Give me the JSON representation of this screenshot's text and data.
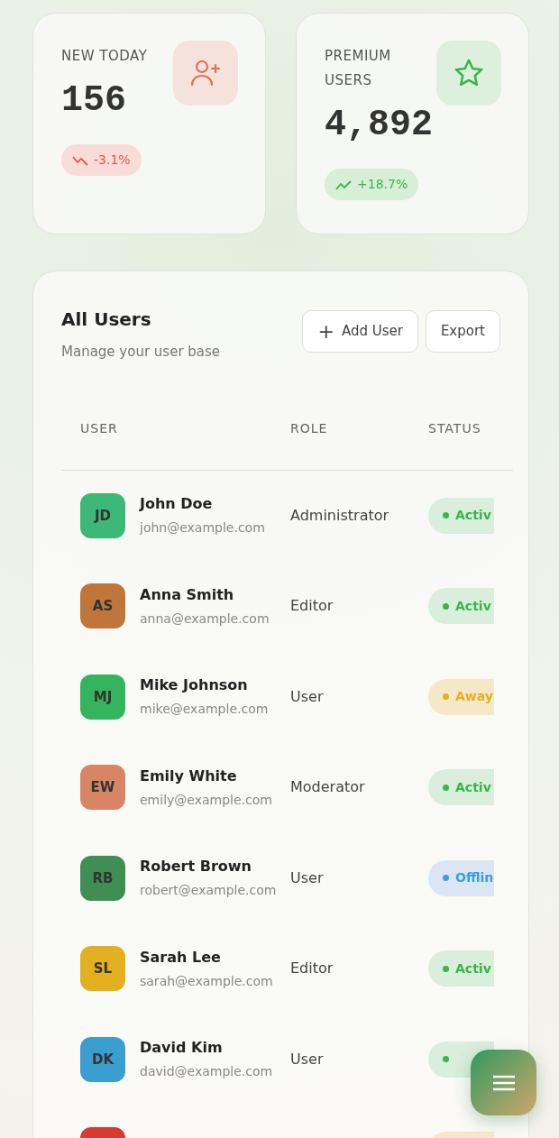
{
  "stats": [
    {
      "label": "NEW TODAY",
      "value": "156",
      "change": "-3.1%",
      "kind": "down"
    },
    {
      "label": "PREMIUM USERS",
      "value": "4,892",
      "change": "+18.7%",
      "kind": "up"
    }
  ],
  "users_card": {
    "title": "All Users",
    "subtitle": "Manage your user base",
    "buttons": [
      {
        "label": "Add User",
        "symbol": "+"
      },
      {
        "label": "Export"
      }
    ],
    "columns": [
      "USER",
      "ROLE",
      "STATUS"
    ],
    "rows": [
      {
        "initials": "JD",
        "name": "John Doe",
        "email": "john@example.com",
        "role": "Administrator",
        "status": "Activ",
        "kind": "active",
        "color": "#3cb878"
      },
      {
        "initials": "AS",
        "name": "Anna Smith",
        "email": "anna@example.com",
        "role": "Editor",
        "status": "Activ",
        "kind": "active",
        "color": "#c0763a"
      },
      {
        "initials": "MJ",
        "name": "Mike Johnson",
        "email": "mike@example.com",
        "role": "User",
        "status": "Away",
        "kind": "away",
        "color": "#35b45e"
      },
      {
        "initials": "EW",
        "name": "Emily White",
        "email": "emily@example.com",
        "role": "Moderator",
        "status": "Activ",
        "kind": "active",
        "color": "#d98565"
      },
      {
        "initials": "RB",
        "name": "Robert Brown",
        "email": "robert@example.com",
        "role": "User",
        "status": "Offlin",
        "kind": "offline",
        "color": "#3f8f55"
      },
      {
        "initials": "SL",
        "name": "Sarah Lee",
        "email": "sarah@example.com",
        "role": "Editor",
        "status": "Activ",
        "kind": "active",
        "color": "#e2b020"
      },
      {
        "initials": "DK",
        "name": "David Kim",
        "email": "david@example.com",
        "role": "User",
        "kind": "active",
        "color": "#3a9fd0"
      },
      {
        "kind": "away",
        "color": "#d63a30"
      }
    ]
  }
}
